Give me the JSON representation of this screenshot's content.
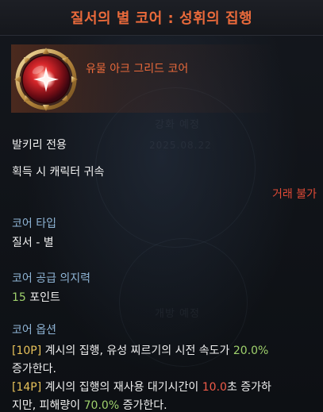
{
  "header": {
    "title": "질서의 별 코어 : 성휘의 집행"
  },
  "item": {
    "grade": "유물 아크 그리드 코어",
    "icon": "star-core-gem-icon"
  },
  "watermark": {
    "line1": "강화 예정",
    "line2": "2025.08.22",
    "line3": "개방 예정"
  },
  "info": {
    "class_restriction": "발키리 전용",
    "bind": "획득 시 캐릭터 귀속",
    "trade": "거래 불가"
  },
  "core_type": {
    "label": "코어 타입",
    "value": "질서 - 별"
  },
  "supply": {
    "label": "코어 공급 의지력",
    "amount": "15",
    "unit": " 포인트"
  },
  "options": {
    "label": "코어 옵션",
    "opt1": {
      "tag": "[10P]",
      "text": " 계시의 집행, 유성 찌르기의 시전 속도가 ",
      "value": "20.0%",
      "cont": "증가한다."
    },
    "opt2": {
      "tag": "[14P]",
      "text": " 계시의 집행의 재사용 대기시간이 ",
      "value1": "10.0",
      "mid": "초 증가하",
      "cont": "지만, 피해량이 ",
      "value2": "70.0%",
      "end": " 증가한다."
    }
  },
  "colors": {
    "title": "#ea6a3b",
    "label": "#8fb5d6",
    "tag": "#e8c25a",
    "good": "#9fd16c",
    "bad": "#f05a48"
  }
}
